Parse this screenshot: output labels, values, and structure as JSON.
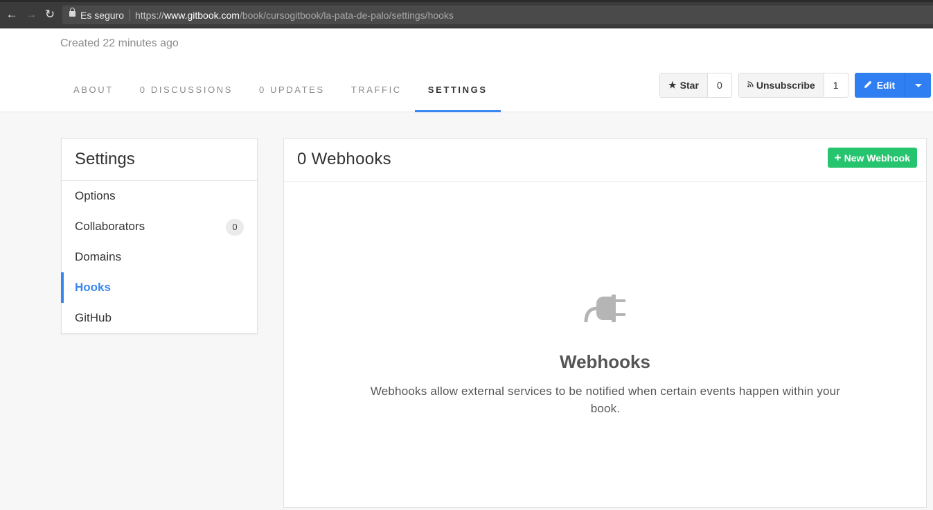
{
  "browser": {
    "secure_label": "Es seguro",
    "url_scheme": "https://",
    "url_host": "www.gitbook.com",
    "url_path": "/book/cursogitbook/la-pata-de-palo/settings/hooks"
  },
  "header": {
    "created": "Created 22 minutes ago",
    "tabs": [
      {
        "label": "ABOUT"
      },
      {
        "label": "0 DISCUSSIONS"
      },
      {
        "label": "0 UPDATES"
      },
      {
        "label": "TRAFFIC"
      },
      {
        "label": "SETTINGS"
      }
    ],
    "active_tab": "SETTINGS",
    "star_label": "Star",
    "star_count": "0",
    "unsubscribe_label": "Unsubscribe",
    "watch_count": "1",
    "edit_label": "Edit"
  },
  "sidebar": {
    "title": "Settings",
    "items": [
      {
        "label": "Options"
      },
      {
        "label": "Collaborators",
        "badge": "0"
      },
      {
        "label": "Domains"
      },
      {
        "label": "Hooks"
      },
      {
        "label": "GitHub"
      }
    ],
    "active_item": "Hooks"
  },
  "panel": {
    "title": "0 Webhooks",
    "new_button": "New Webhook",
    "empty_icon": "plug-icon",
    "empty_title": "Webhooks",
    "empty_description": "Webhooks allow external services to be notified when certain events happen within your book."
  },
  "colors": {
    "accent_blue": "#3a86f0",
    "edit_blue": "#2f7ff2",
    "new_green": "#27c46f"
  }
}
